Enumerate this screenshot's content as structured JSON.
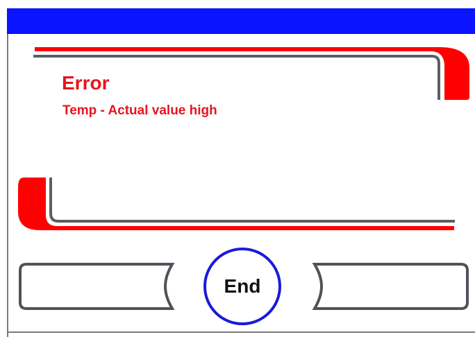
{
  "message": {
    "title": "Error",
    "text": "Temp - Actual value high"
  },
  "buttons": {
    "left_label": "",
    "center_label": "End",
    "right_label": ""
  },
  "colors": {
    "title_bar": "#0a14ff",
    "error_text": "#e8141e",
    "frame_red": "#ff0000",
    "frame_gray": "#5a5f64",
    "button_outline": "#4d5359",
    "end_button_ring": "#1a1ad8",
    "border": "#7a7a7a"
  }
}
